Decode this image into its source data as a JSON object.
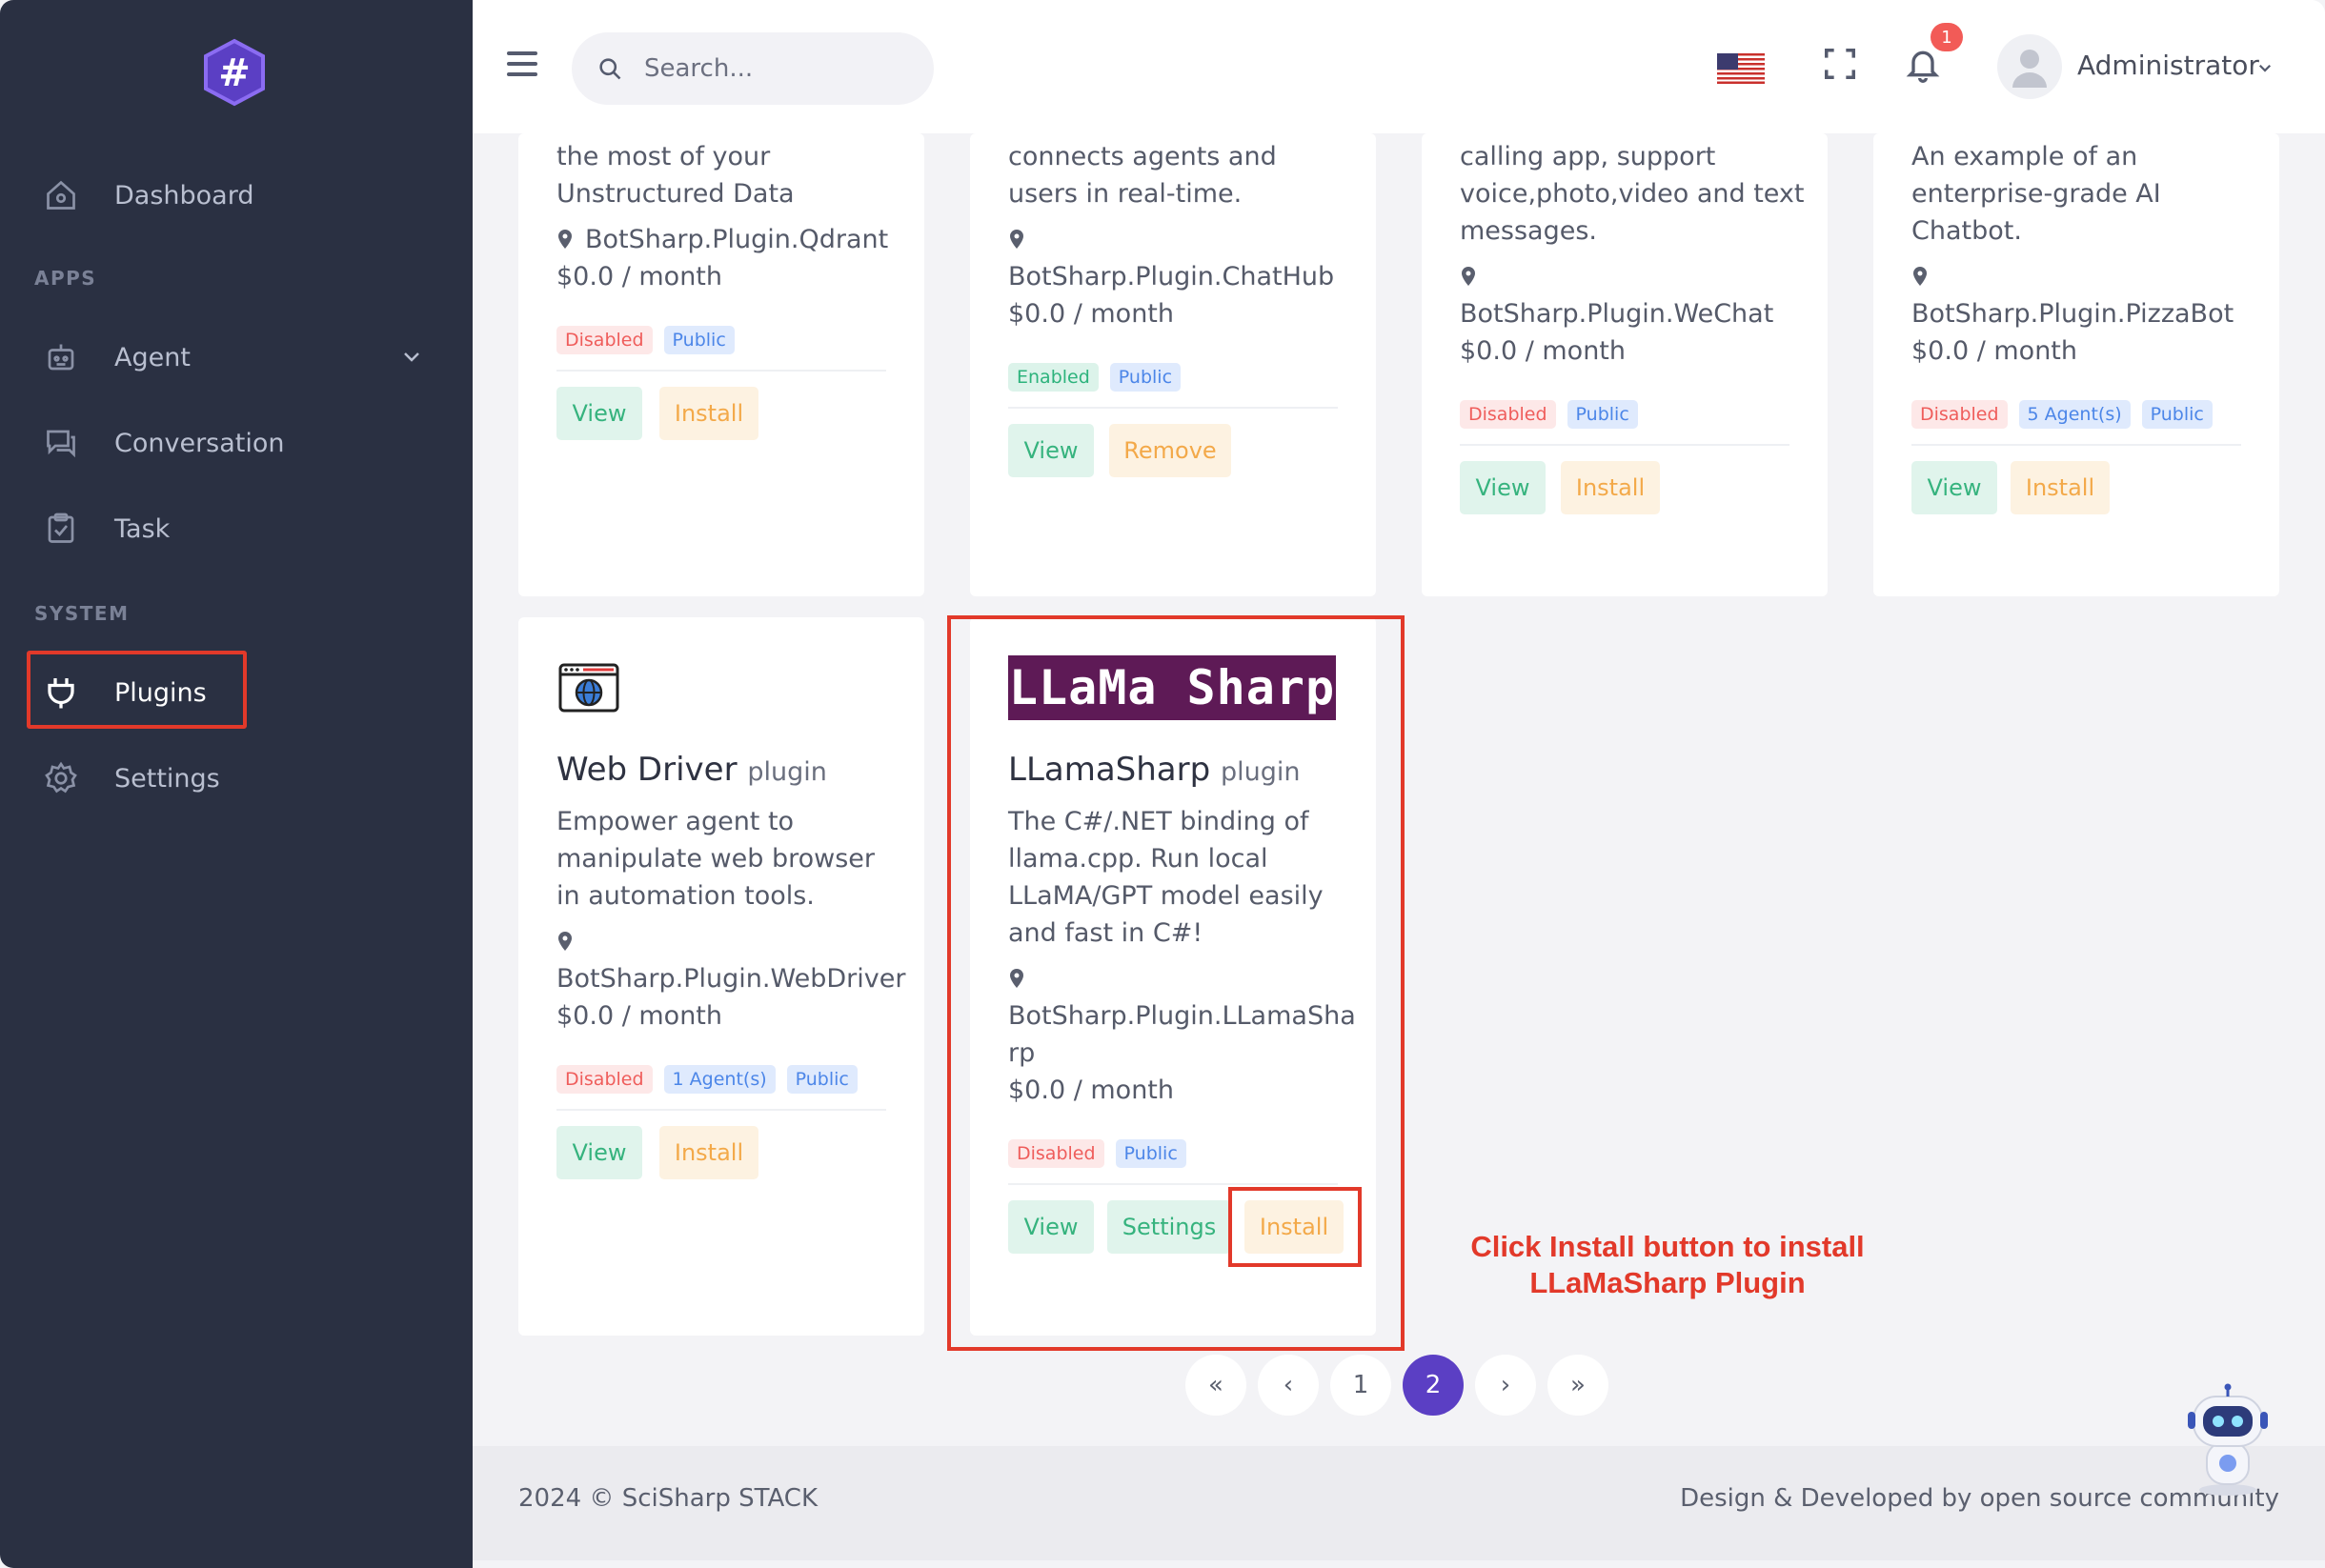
{
  "sidebar": {
    "logo_icon": "hashtag-hexagon-logo",
    "items": [
      {
        "label": "Dashboard",
        "icon": "home-icon"
      },
      {
        "label": "Agent",
        "icon": "robot-icon"
      },
      {
        "label": "Conversation",
        "icon": "chat-icon"
      },
      {
        "label": "Task",
        "icon": "clipboard-check-icon"
      },
      {
        "label": "Plugins",
        "icon": "plug-icon"
      },
      {
        "label": "Settings",
        "icon": "gear-icon"
      }
    ],
    "sections": {
      "apps": "APPS",
      "system": "SYSTEM"
    }
  },
  "header": {
    "search_placeholder": "Search...",
    "notification_count": "1",
    "user_name": "Administrator"
  },
  "cards_top": [
    {
      "description": [
        "the most of your",
        "Unstructured Data"
      ],
      "package": "BotSharp.Plugin.Qdrant",
      "price": "$0.0 / month",
      "tags": [
        "Disabled",
        "Public"
      ],
      "buttons": [
        "View",
        "Install"
      ]
    },
    {
      "description": [
        "connects agents and",
        "users in real-time."
      ],
      "package": "BotSharp.Plugin.ChatHub",
      "price": "$0.0 / month",
      "tags": [
        "Enabled",
        "Public"
      ],
      "buttons": [
        "View",
        "Remove"
      ]
    },
    {
      "description": [
        "calling app, support",
        "voice,photo,video and text",
        "messages."
      ],
      "package": "BotSharp.Plugin.WeChat",
      "price": "$0.0 / month",
      "tags": [
        "Disabled",
        "Public"
      ],
      "buttons": [
        "View",
        "Install"
      ]
    },
    {
      "description": [
        "An example of an",
        "enterprise-grade AI",
        "Chatbot."
      ],
      "package": "BotSharp.Plugin.PizzaBot",
      "price": "$0.0 / month",
      "tags": [
        "Disabled",
        "5 Agent(s)",
        "Public"
      ],
      "buttons": [
        "View",
        "Install"
      ]
    }
  ],
  "card_webdriver": {
    "title": "Web Driver",
    "suffix": "plugin",
    "description": [
      "Empower agent to",
      "manipulate web browser",
      "in automation tools."
    ],
    "package": "BotSharp.Plugin.WebDriver",
    "price": "$0.0 / month",
    "tags": [
      "Disabled",
      "1 Agent(s)",
      "Public"
    ],
    "buttons": [
      "View",
      "Install"
    ]
  },
  "card_llama": {
    "logo_text": "LLaMa Sharp",
    "title": "LLamaSharp",
    "suffix": "plugin",
    "description": [
      "The C#/.NET binding of",
      "llama.cpp. Run local",
      "LLaMA/GPT model easily",
      "and fast in C#!"
    ],
    "package_lines": [
      "BotSharp.Plugin.LLamaSha",
      "rp"
    ],
    "price": "$0.0 / month",
    "tags": [
      "Disabled",
      "Public"
    ],
    "buttons": [
      "View",
      "Settings",
      "Install"
    ]
  },
  "annotation": [
    "Click Install button to install",
    "LLaMaSharp Plugin"
  ],
  "pagination": [
    "«",
    "‹",
    "1",
    "2",
    "›",
    "»"
  ],
  "footer": {
    "left": "2024 © SciSharp STACK",
    "right": "Design & Developed by open source community"
  },
  "colors": {
    "sidebar": "#2a3042",
    "accent": "#5b3fc4",
    "annotation": "#e2392a"
  }
}
